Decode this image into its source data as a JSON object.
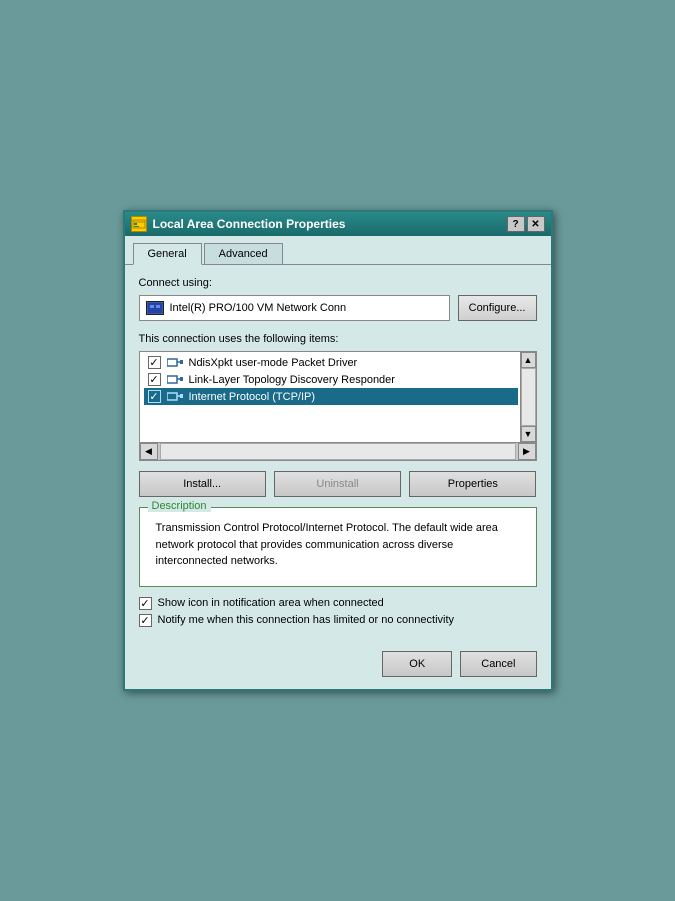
{
  "window": {
    "title": "Local Area Connection Properties",
    "help_label": "?",
    "close_label": "✕"
  },
  "tabs": [
    {
      "id": "general",
      "label": "General",
      "active": true
    },
    {
      "id": "advanced",
      "label": "Advanced",
      "active": false
    }
  ],
  "general": {
    "connect_using_label": "Connect using:",
    "adapter_name": "Intel(R) PRO/100 VM Network Conn",
    "configure_label": "Configure...",
    "items_label": "This connection uses the following items:",
    "items": [
      {
        "id": 1,
        "checked": true,
        "label": "NdisXpkt user-mode Packet Driver",
        "selected": false
      },
      {
        "id": 2,
        "checked": true,
        "label": "Link-Layer Topology Discovery Responder",
        "selected": false
      },
      {
        "id": 3,
        "checked": true,
        "label": "Internet Protocol (TCP/IP)",
        "selected": true
      }
    ],
    "install_label": "Install...",
    "uninstall_label": "Uninstall",
    "properties_label": "Properties",
    "description_title": "Description",
    "description_text": "Transmission Control Protocol/Internet Protocol. The default wide area network protocol that provides communication across diverse interconnected networks.",
    "show_icon_label": "Show icon in notification area when connected",
    "notify_label": "Notify me when this connection has limited or no connectivity",
    "show_icon_checked": true,
    "notify_checked": true,
    "ok_label": "OK",
    "cancel_label": "Cancel"
  }
}
